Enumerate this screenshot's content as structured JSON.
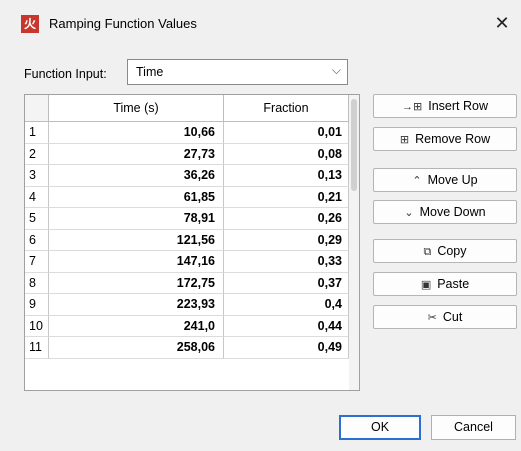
{
  "window": {
    "title": "Ramping Function Values",
    "app_icon_glyph": "火",
    "close_glyph": "✕",
    "accent": "#c8372d"
  },
  "function_input": {
    "label": "Function Input:",
    "selected": "Time",
    "chevron_glyph": "⌵"
  },
  "table": {
    "columns": [
      "",
      "Time (s)",
      "Fraction"
    ],
    "rows": [
      {
        "idx": "1",
        "time": "10,66",
        "fraction": "0,01"
      },
      {
        "idx": "2",
        "time": "27,73",
        "fraction": "0,08"
      },
      {
        "idx": "3",
        "time": "36,26",
        "fraction": "0,13"
      },
      {
        "idx": "4",
        "time": "61,85",
        "fraction": "0,21"
      },
      {
        "idx": "5",
        "time": "78,91",
        "fraction": "0,26"
      },
      {
        "idx": "6",
        "time": "121,56",
        "fraction": "0,29"
      },
      {
        "idx": "7",
        "time": "147,16",
        "fraction": "0,33"
      },
      {
        "idx": "8",
        "time": "172,75",
        "fraction": "0,37"
      },
      {
        "idx": "9",
        "time": "223,93",
        "fraction": "0,4"
      },
      {
        "idx": "10",
        "time": "241,0",
        "fraction": "0,44"
      },
      {
        "idx": "11",
        "time": "258,06",
        "fraction": "0,49"
      }
    ]
  },
  "actions": {
    "insert_row": {
      "label": "Insert Row",
      "icon": "→⊞"
    },
    "remove_row": {
      "label": "Remove Row",
      "icon": "⊞"
    },
    "move_up": {
      "label": "Move Up",
      "icon": "⌃"
    },
    "move_down": {
      "label": "Move Down",
      "icon": "⌄"
    },
    "copy": {
      "label": "Copy",
      "icon": "⧉"
    },
    "paste": {
      "label": "Paste",
      "icon": "▣"
    },
    "cut": {
      "label": "Cut",
      "icon": "✂"
    }
  },
  "footer": {
    "ok": "OK",
    "cancel": "Cancel"
  }
}
